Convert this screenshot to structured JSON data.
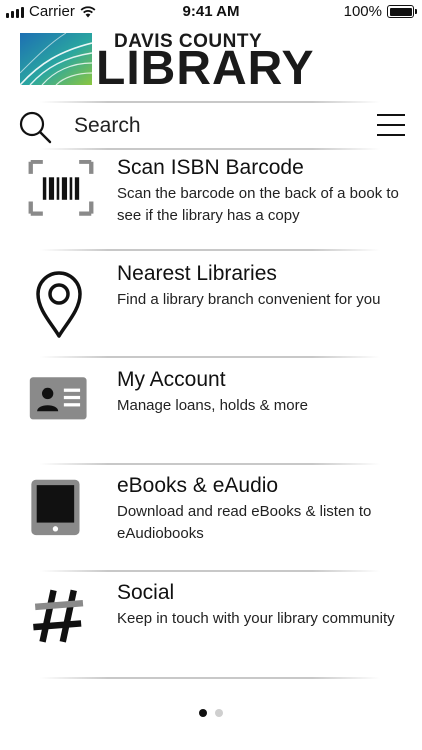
{
  "status_bar": {
    "carrier": "Carrier",
    "time": "9:41 AM",
    "battery": "100%"
  },
  "logo": {
    "top_text": "DAVIS COUNTY",
    "main_text": "LIBRARY"
  },
  "search": {
    "placeholder": "Search",
    "icon": "search-icon"
  },
  "menu": {
    "icon": "hamburger-menu-icon"
  },
  "items": [
    {
      "title": "Scan ISBN Barcode",
      "description": "Scan the barcode on the back of a book to see if the library has a copy",
      "icon": "barcode-icon"
    },
    {
      "title": "Nearest Libraries",
      "description": "Find a library branch convenient for you",
      "icon": "map-pin-icon"
    },
    {
      "title": "My Account",
      "description": "Manage loans, holds & more",
      "icon": "id-card-icon"
    },
    {
      "title": "eBooks & eAudio",
      "description": "Download and read eBooks & listen to eAudiobooks",
      "icon": "tablet-icon"
    },
    {
      "title": "Social",
      "description": "Keep in touch with your library community",
      "icon": "hashtag-icon"
    }
  ],
  "pagination": {
    "total": 2,
    "current": 1
  },
  "colors": {
    "icon_gray": "#8a8a8a",
    "text": "#111111",
    "divider": "#c8c8c8"
  }
}
